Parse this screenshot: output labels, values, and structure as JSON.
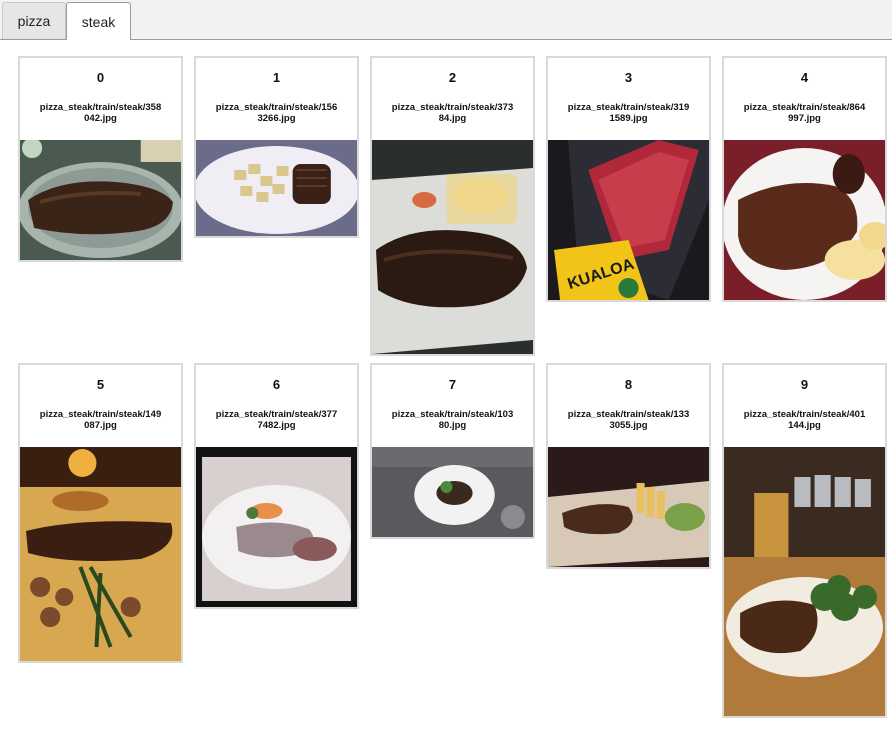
{
  "tabs": [
    {
      "label": "pizza",
      "active": false
    },
    {
      "label": "steak",
      "active": true
    }
  ],
  "images": [
    {
      "index": "0",
      "path": "pizza_steak/train/steak/358042.jpg",
      "name_line1": "pizza_steak/train/steak/358",
      "name_line2": "042.jpg"
    },
    {
      "index": "1",
      "path": "pizza_steak/train/steak/1563266.jpg",
      "name_line1": "pizza_steak/train/steak/156",
      "name_line2": "3266.jpg"
    },
    {
      "index": "2",
      "path": "pizza_steak/train/steak/37384.jpg",
      "name_line1": "pizza_steak/train/steak/373",
      "name_line2": "84.jpg"
    },
    {
      "index": "3",
      "path": "pizza_steak/train/steak/3191589.jpg",
      "name_line1": "pizza_steak/train/steak/319",
      "name_line2": "1589.jpg"
    },
    {
      "index": "4",
      "path": "pizza_steak/train/steak/864997.jpg",
      "name_line1": "pizza_steak/train/steak/864",
      "name_line2": "997.jpg"
    },
    {
      "index": "5",
      "path": "pizza_steak/train/steak/149087.jpg",
      "name_line1": "pizza_steak/train/steak/149",
      "name_line2": "087.jpg"
    },
    {
      "index": "6",
      "path": "pizza_steak/train/steak/3777482.jpg",
      "name_line1": "pizza_steak/train/steak/377",
      "name_line2": "7482.jpg"
    },
    {
      "index": "7",
      "path": "pizza_steak/train/steak/10380.jpg",
      "name_line1": "pizza_steak/train/steak/103",
      "name_line2": "80.jpg"
    },
    {
      "index": "8",
      "path": "pizza_steak/train/steak/1333055.jpg",
      "name_line1": "pizza_steak/train/steak/133",
      "name_line2": "3055.jpg"
    },
    {
      "index": "9",
      "path": "pizza_steak/train/steak/401144.jpg",
      "name_line1": "pizza_steak/train/steak/401",
      "name_line2": "144.jpg"
    }
  ]
}
